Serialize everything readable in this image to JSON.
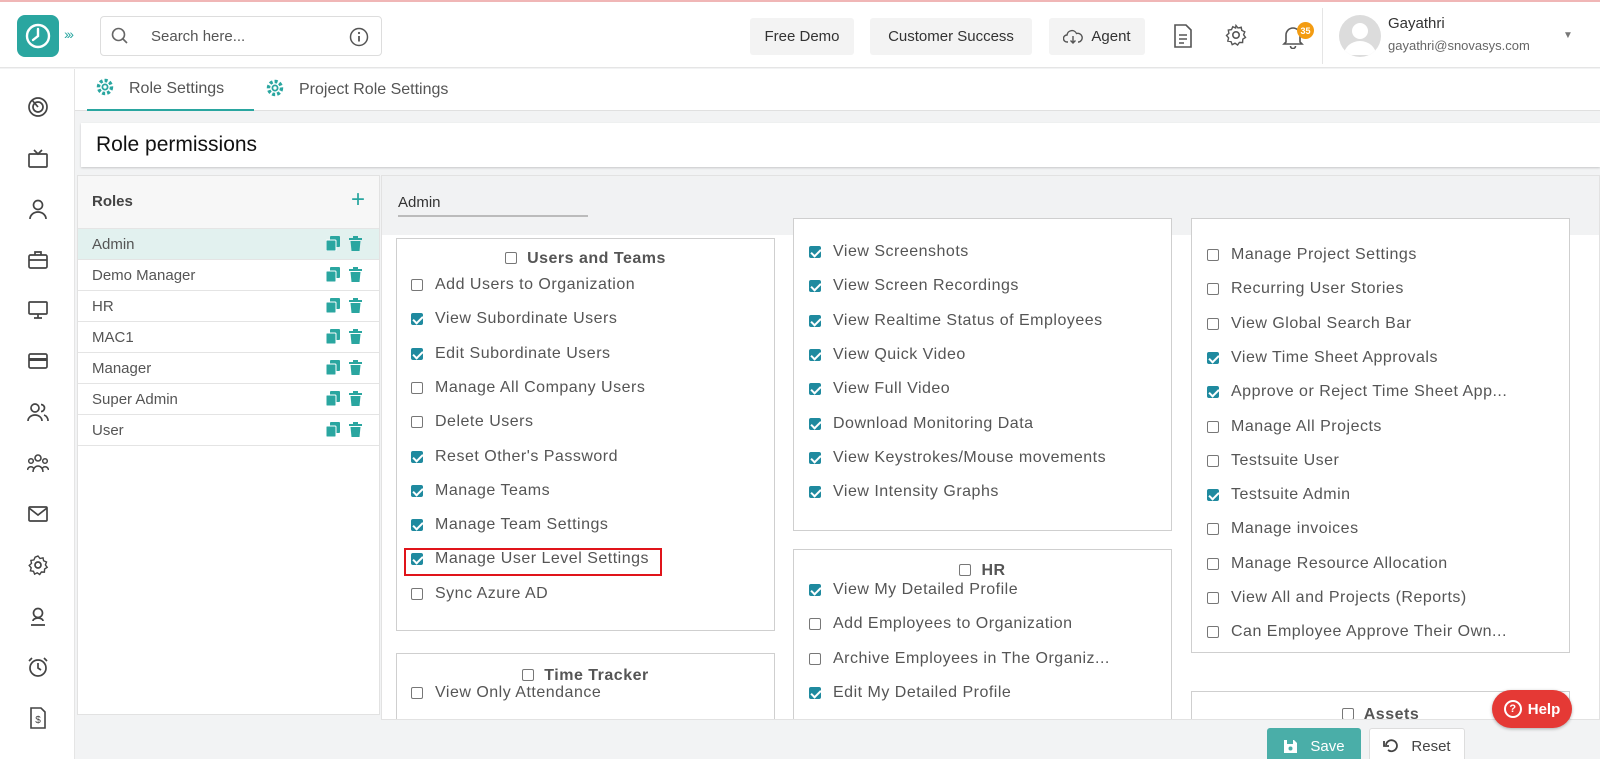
{
  "header": {
    "search_placeholder": "Search here...",
    "free_demo": "Free Demo",
    "customer_success": "Customer Success",
    "agent": "Agent",
    "notification_count": "35",
    "user_name": "Gayathri",
    "user_email": "gayathri@snovasys.com"
  },
  "sidebar_icons": [
    "target-icon",
    "tv-icon",
    "user-icon",
    "briefcase-icon",
    "monitor-icon",
    "card-icon",
    "users-icon",
    "team-icon",
    "mail-icon",
    "settings-icon",
    "badge-user-icon",
    "alarm-icon",
    "invoice-icon"
  ],
  "tabs": [
    {
      "label": "Role Settings",
      "active": true
    },
    {
      "label": "Project Role Settings",
      "active": false
    }
  ],
  "page_title": "Role permissions",
  "roles": {
    "title": "Roles",
    "items": [
      "Admin",
      "Demo Manager",
      "HR",
      "MAC1",
      "Manager",
      "Super Admin",
      "User"
    ],
    "selected": "Admin"
  },
  "selected_role": "Admin",
  "columns": {
    "col1": {
      "users_teams": {
        "title": "Users and Teams",
        "checked": false,
        "items": [
          {
            "label": "Add Users to Organization",
            "checked": false
          },
          {
            "label": "View Subordinate Users",
            "checked": true
          },
          {
            "label": "Edit Subordinate Users",
            "checked": true
          },
          {
            "label": "Manage All Company Users",
            "checked": false
          },
          {
            "label": "Delete Users",
            "checked": false
          },
          {
            "label": "Reset Other's Password",
            "checked": true
          },
          {
            "label": "Manage Teams",
            "checked": true
          },
          {
            "label": "Manage Team Settings",
            "checked": true
          },
          {
            "label": "Manage User Level Settings",
            "checked": true
          },
          {
            "label": "Sync Azure AD",
            "checked": false
          }
        ]
      },
      "time_tracker": {
        "title": "Time Tracker",
        "checked": false,
        "items": [
          {
            "label": "View Only Attendance",
            "checked": false
          }
        ]
      }
    },
    "col2": {
      "monitoring": {
        "items": [
          {
            "label": "View Screenshots",
            "checked": true
          },
          {
            "label": "View Screen Recordings",
            "checked": true
          },
          {
            "label": "View Realtime Status of Employees",
            "checked": true
          },
          {
            "label": "View Quick Video",
            "checked": true
          },
          {
            "label": "View Full Video",
            "checked": true
          },
          {
            "label": "Download Monitoring Data",
            "checked": true
          },
          {
            "label": "View Keystrokes/Mouse movements",
            "checked": true
          },
          {
            "label": "View Intensity Graphs",
            "checked": true
          }
        ]
      },
      "hr": {
        "title": "HR",
        "checked": false,
        "items": [
          {
            "label": "View My Detailed Profile",
            "checked": true
          },
          {
            "label": "Add Employees to Organization",
            "checked": false
          },
          {
            "label": "Archive Employees in The Organiz...",
            "checked": false
          },
          {
            "label": "Edit My Detailed Profile",
            "checked": true
          }
        ]
      }
    },
    "col3": {
      "projects": {
        "items": [
          {
            "label": "Manage Project Settings",
            "checked": false
          },
          {
            "label": "Recurring User Stories",
            "checked": false
          },
          {
            "label": "View Global Search Bar",
            "checked": false
          },
          {
            "label": "View Time Sheet Approvals",
            "checked": true
          },
          {
            "label": "Approve or Reject Time Sheet App...",
            "checked": true
          },
          {
            "label": "Manage All Projects",
            "checked": false
          },
          {
            "label": "Testsuite User",
            "checked": false
          },
          {
            "label": "Testsuite Admin",
            "checked": true
          },
          {
            "label": "Manage invoices",
            "checked": false
          },
          {
            "label": "Manage Resource Allocation",
            "checked": false
          },
          {
            "label": "View All and Projects (Reports)",
            "checked": false
          },
          {
            "label": "Can Employee Approve Their Own...",
            "checked": false
          }
        ]
      },
      "assets": {
        "title": "Assets",
        "checked": false
      }
    }
  },
  "buttons": {
    "help": "Help",
    "save": "Save",
    "reset": "Reset"
  },
  "colors": {
    "accent": "#2aa6a0",
    "checkbox": "#1f8a9f",
    "highlight": "#e0141a",
    "help": "#e53935"
  }
}
